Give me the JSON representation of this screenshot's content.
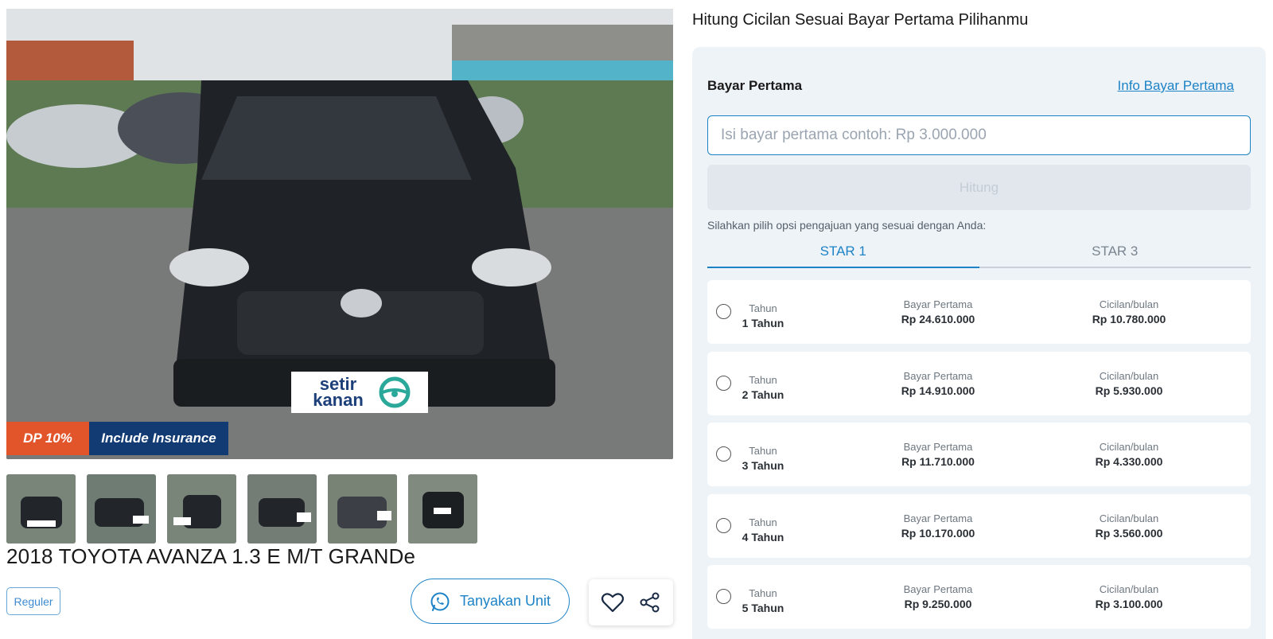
{
  "listing": {
    "badges": {
      "dp": "DP 10%",
      "insurance": "Include Insurance"
    },
    "brand_sticker": "setir kanan",
    "title": "2018 TOYOTA AVANZA 1.3 E M/T GRANDe",
    "tag": "Reguler",
    "ask_button": "Tanyakan Unit",
    "thumbnails": [
      "thumb-1",
      "thumb-2",
      "thumb-3",
      "thumb-4",
      "thumb-5",
      "thumb-6"
    ],
    "icons": {
      "ask": "whatsapp-icon",
      "favorite": "heart-icon",
      "share": "share-icon"
    }
  },
  "calculator": {
    "heading": "Hitung Cicilan Sesuai Bayar Pertama Pilihanmu",
    "label": "Bayar Pertama",
    "info_link": "Info Bayar Pertama",
    "input_placeholder": "Isi bayar pertama contoh: Rp 3.000.000",
    "input_value": "",
    "calc_button": "Hitung",
    "hint": "Silahkan pilih opsi pengajuan yang sesuai dengan Anda:",
    "tabs": [
      {
        "label": "STAR 1",
        "active": true
      },
      {
        "label": "STAR 3",
        "active": false
      }
    ],
    "column_labels": {
      "tenor": "Tahun",
      "down_payment": "Bayar Pertama",
      "installment": "Cicilan/bulan"
    },
    "options": [
      {
        "tenor": "1 Tahun",
        "down_payment": "Rp 24.610.000",
        "installment": "Rp 10.780.000"
      },
      {
        "tenor": "2 Tahun",
        "down_payment": "Rp 14.910.000",
        "installment": "Rp 5.930.000"
      },
      {
        "tenor": "3 Tahun",
        "down_payment": "Rp 11.710.000",
        "installment": "Rp 4.330.000"
      },
      {
        "tenor": "4 Tahun",
        "down_payment": "Rp 10.170.000",
        "installment": "Rp 3.560.000"
      },
      {
        "tenor": "5 Tahun",
        "down_payment": "Rp 9.250.000",
        "installment": "Rp 3.100.000"
      }
    ]
  },
  "colors": {
    "accent": "#1d83c6",
    "dp_badge": "#e2542a",
    "insurance_badge": "#123b73",
    "panel_bg": "#eef3f8"
  }
}
